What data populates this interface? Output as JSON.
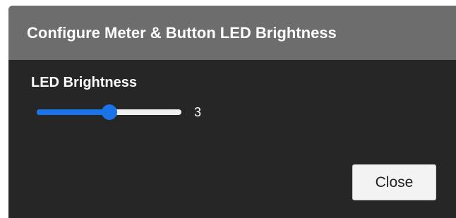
{
  "dialog": {
    "title": "Configure Meter & Button LED Brightness",
    "close_label": "Close"
  },
  "brightness": {
    "label": "LED Brightness",
    "value_text": "3",
    "value": 3,
    "min": 0,
    "max": 6,
    "accent_color": "#1a73e8"
  }
}
